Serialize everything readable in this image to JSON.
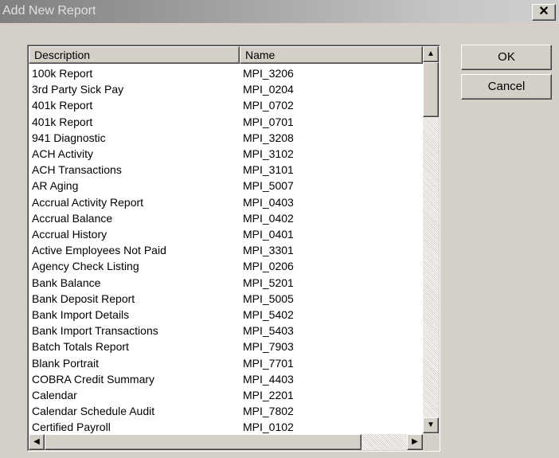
{
  "window": {
    "title": "Add New Report",
    "close_glyph": "✕"
  },
  "list": {
    "columns": [
      "Description",
      "Name"
    ],
    "rows": [
      [
        "100k Report",
        "MPI_3206"
      ],
      [
        "3rd Party Sick Pay",
        "MPI_0204"
      ],
      [
        "401k Report",
        "MPI_0702"
      ],
      [
        "401k Report",
        "MPI_0701"
      ],
      [
        "941 Diagnostic",
        "MPI_3208"
      ],
      [
        "ACH Activity",
        "MPI_3102"
      ],
      [
        "ACH Transactions",
        "MPI_3101"
      ],
      [
        "AR Aging",
        "MPI_5007"
      ],
      [
        "Accrual Activity Report",
        "MPI_0403"
      ],
      [
        "Accrual Balance",
        "MPI_0402"
      ],
      [
        "Accrual History",
        "MPI_0401"
      ],
      [
        "Active Employees Not Paid",
        "MPI_3301"
      ],
      [
        "Agency Check Listing",
        "MPI_0206"
      ],
      [
        "Bank Balance",
        "MPI_5201"
      ],
      [
        "Bank Deposit Report",
        "MPI_5005"
      ],
      [
        "Bank Import Details",
        "MPI_5402"
      ],
      [
        "Bank Import Transactions",
        "MPI_5403"
      ],
      [
        "Batch Totals Report",
        "MPI_7903"
      ],
      [
        "Blank Portrait",
        "MPI_7701"
      ],
      [
        "COBRA Credit Summary",
        "MPI_4403"
      ],
      [
        "Calendar",
        "MPI_2201"
      ],
      [
        "Calendar Schedule Audit",
        "MPI_7802"
      ],
      [
        "Certified Payroll",
        "MPI_0102"
      ]
    ]
  },
  "buttons": {
    "ok": "OK",
    "cancel": "Cancel"
  },
  "scrollbar": {
    "up": "▲",
    "down": "▼",
    "left": "◀",
    "right": "▶"
  }
}
